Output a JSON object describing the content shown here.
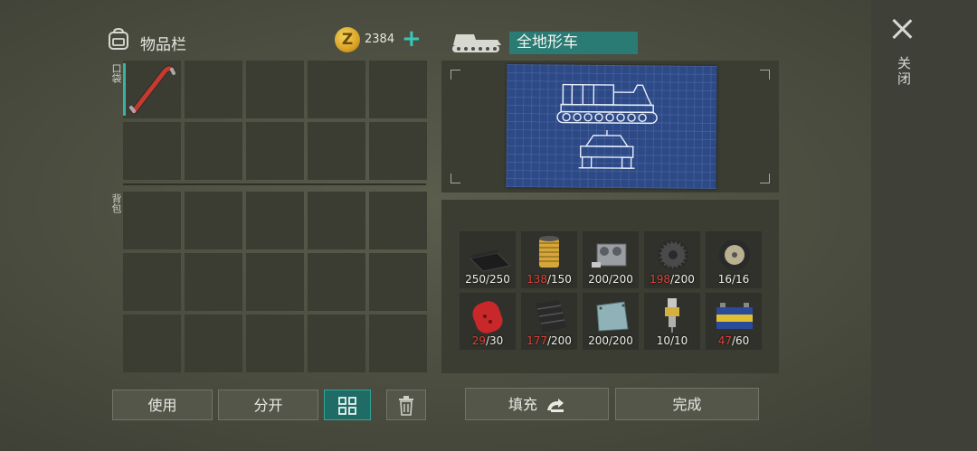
{
  "inventory": {
    "title": "物品栏",
    "pocket_label": "口袋",
    "backpack_label": "背包",
    "currency": {
      "symbol": "Z",
      "amount": "2384"
    }
  },
  "vehicle": {
    "name": "全地形车"
  },
  "close_label": "关闭",
  "buttons": {
    "use": "使用",
    "split": "分开",
    "fill": "填充",
    "done": "完成"
  },
  "materials": [
    {
      "icon": "rubber-sheet-icon",
      "current": "250",
      "required": "/250",
      "low": false
    },
    {
      "icon": "oil-filter-icon",
      "current": "138",
      "required": "/150",
      "low": true
    },
    {
      "icon": "engine-block-icon",
      "current": "200",
      "required": "/200",
      "low": false
    },
    {
      "icon": "gear-icon",
      "current": "198",
      "required": "/200",
      "low": true
    },
    {
      "icon": "wheel-rim-icon",
      "current": "16",
      "required": "/16",
      "low": false
    },
    {
      "icon": "gas-cylinder-icon",
      "current": "29",
      "required": "/30",
      "low": true
    },
    {
      "icon": "tread-belt-icon",
      "current": "177",
      "required": "/200",
      "low": true
    },
    {
      "icon": "metal-plate-icon",
      "current": "200",
      "required": "/200",
      "low": false
    },
    {
      "icon": "spark-plug-icon",
      "current": "10",
      "required": "/10",
      "low": false
    },
    {
      "icon": "car-battery-icon",
      "current": "47",
      "required": "/60",
      "low": true
    }
  ],
  "colors": {
    "accent": "#37c9b6",
    "low_count": "#e0413a",
    "vehicle_label_bg": "#2a7b74"
  }
}
